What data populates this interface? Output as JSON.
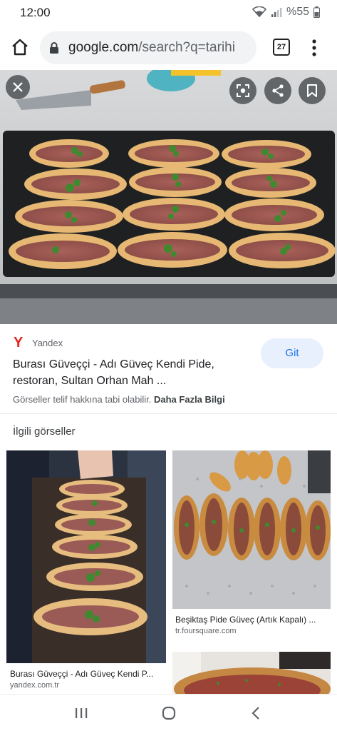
{
  "status_bar": {
    "time": "12:00",
    "battery": "%55"
  },
  "browser": {
    "url_domain": "google.com",
    "url_path": "/search?q=tarihi",
    "tab_count": "27"
  },
  "result": {
    "source_name": "Yandex",
    "source_logo": "Y",
    "title": "Burası Güveççi - Adı Güveç Kendi Pide, restoran, Sultan Orhan Mah ...",
    "visit_label": "Git",
    "copyright_text": "Görseller telif hakkına tabi olabilir.",
    "more_info_label": "Daha Fazla Bilgi"
  },
  "related": {
    "heading": "İlgili görseller",
    "items": [
      {
        "caption": "Burası Güveççi - Adı Güveç Kendi P...",
        "source": "yandex.com.tr"
      },
      {
        "caption": "Beşiktaş Pide Güveç (Artık Kapalı) ...",
        "source": "tr.foursquare.com"
      }
    ]
  }
}
